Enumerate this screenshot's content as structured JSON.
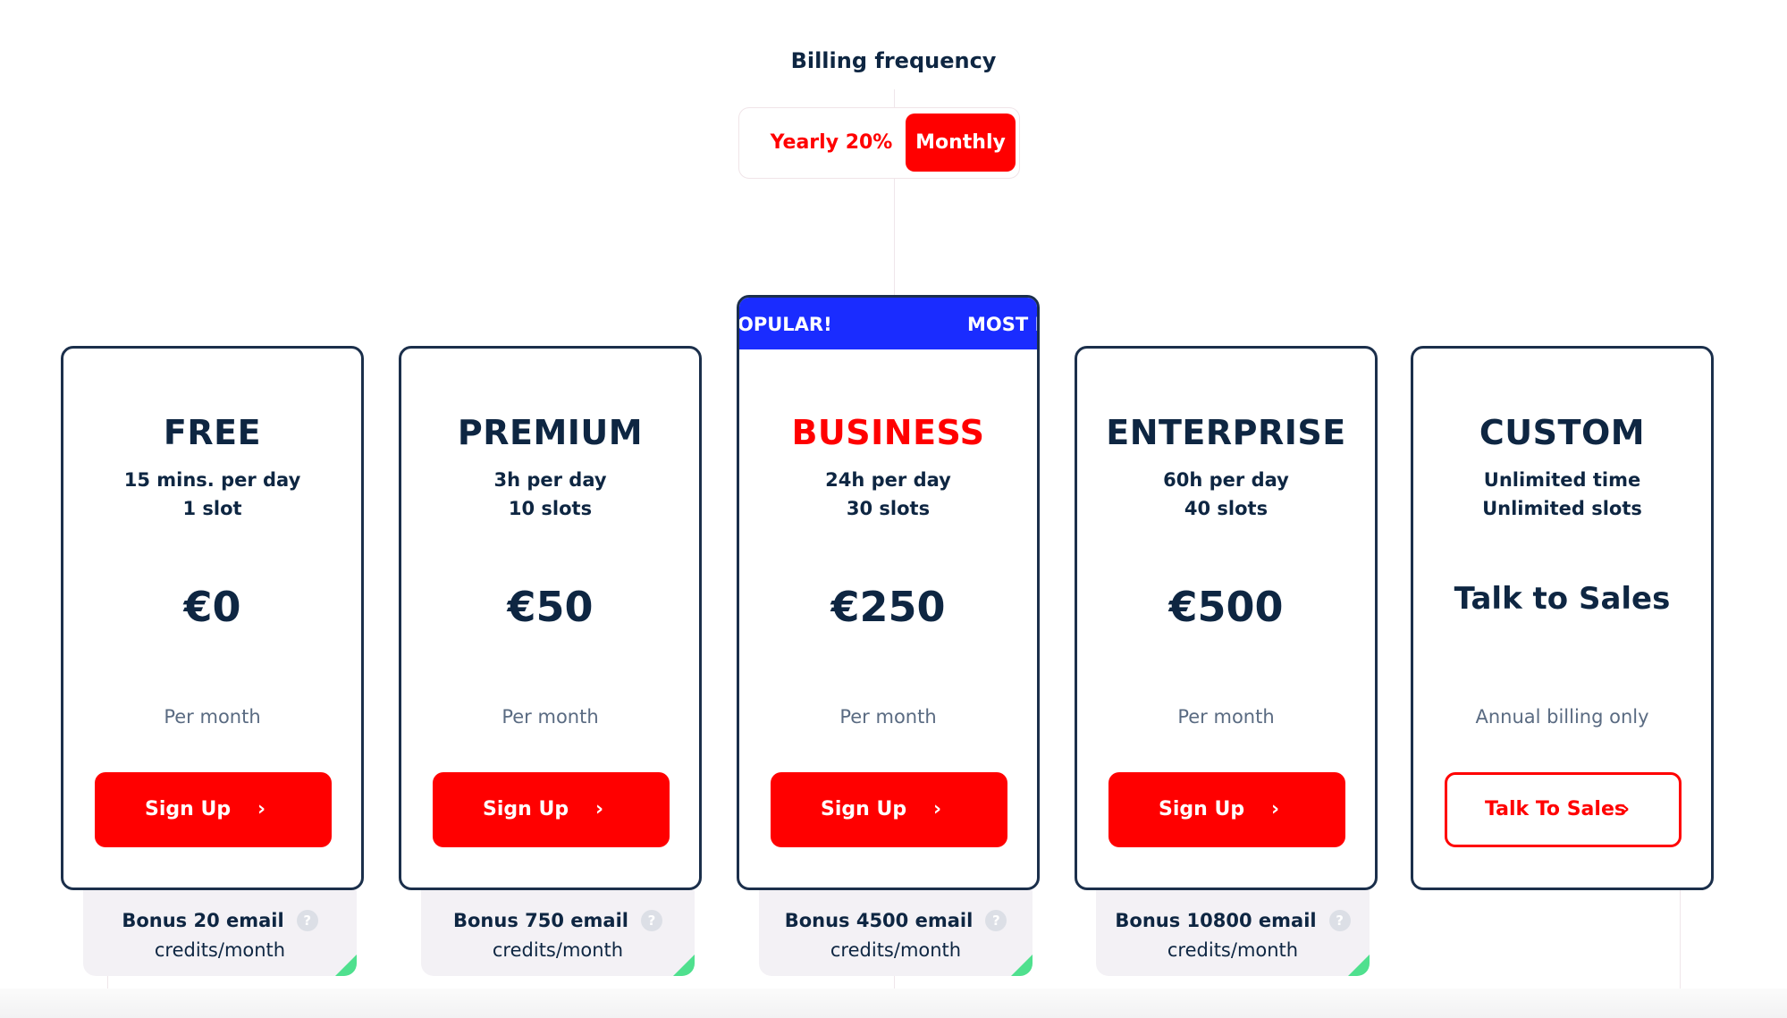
{
  "billing": {
    "title": "Billing frequency",
    "options": [
      {
        "label": "Yearly 20%",
        "selected": false
      },
      {
        "label": "Monthly",
        "selected": true
      }
    ]
  },
  "colors": {
    "accent": "#ff0000",
    "text": "#0e2642",
    "banner": "#1a2cff",
    "bonus_bg": "#f3f1f5",
    "corner": "#4fe08e"
  },
  "plans": [
    {
      "name": "FREE",
      "feature1": "15 mins. per day",
      "feature2": "1 slot",
      "price": "€0",
      "period": "Per month",
      "cta": "Sign Up",
      "cta_icon": "chevron-right-icon",
      "bonus_line1": "Bonus 20 email",
      "bonus_line2": "credits/month"
    },
    {
      "name": "PREMIUM",
      "feature1": "3h per day",
      "feature2": "10 slots",
      "price": "€50",
      "period": "Per month",
      "cta": "Sign Up",
      "cta_icon": "chevron-right-icon",
      "bonus_line1": "Bonus 750 email",
      "bonus_line2": "credits/month"
    },
    {
      "name": "BUSINESS",
      "badge": "MOST POPULAR!",
      "badge_visible_left": "OPULAR!",
      "badge_visible_right": "MOST P",
      "feature1": "24h per day",
      "feature2": "30 slots",
      "price": "€250",
      "period": "Per month",
      "cta": "Sign Up",
      "cta_icon": "chevron-right-icon",
      "bonus_line1": "Bonus 4500 email",
      "bonus_line2": "credits/month"
    },
    {
      "name": "ENTERPRISE",
      "feature1": "60h per day",
      "feature2": "40 slots",
      "price": "€500",
      "period": "Per month",
      "cta": "Sign Up",
      "cta_icon": "chevron-right-icon",
      "bonus_line1": "Bonus 10800 email",
      "bonus_line2": "credits/month"
    },
    {
      "name": "CUSTOM",
      "feature1": "Unlimited time",
      "feature2": "Unlimited slots",
      "price": "Talk to Sales",
      "period": "Annual billing only",
      "cta": "Talk To Sales",
      "cta_icon": "chevron-right-icon"
    }
  ],
  "icons": {
    "chevron": "›",
    "help": "?"
  }
}
